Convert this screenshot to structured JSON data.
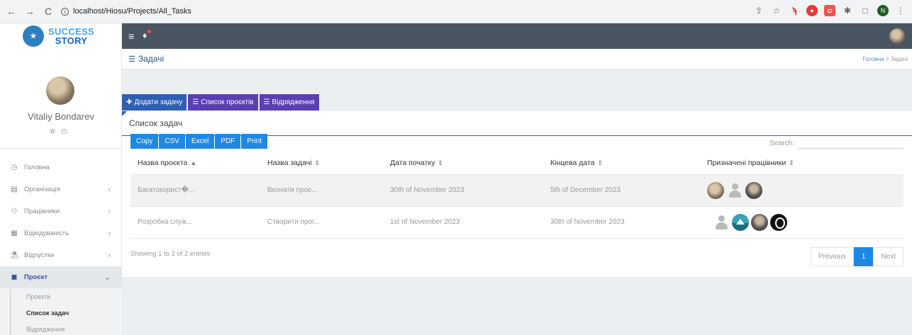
{
  "browser": {
    "url": "localhost/Hiosu/Projects/All_Tasks"
  },
  "brand": {
    "line1": "SUCCESS",
    "line2": "STORY"
  },
  "user": {
    "name": "Vitaliy Bondarev"
  },
  "sidebar": {
    "items": [
      {
        "label": "Головна",
        "icon": "dashboard-icon"
      },
      {
        "label": "Організація",
        "icon": "building-icon"
      },
      {
        "label": "Працівники",
        "icon": "users-icon"
      },
      {
        "label": "Відвідуваність",
        "icon": "clipboard-icon"
      },
      {
        "label": "Відпустки",
        "icon": "beach-icon"
      },
      {
        "label": "Проєкт",
        "icon": "briefcase-icon"
      }
    ],
    "submenu": [
      "Проєкти",
      "Список задач",
      "Відрядження"
    ]
  },
  "header": {
    "title": "Задачі",
    "breadcrumb_home": "Головна",
    "breadcrumb_sep": ">",
    "breadcrumb_current": "Задачі"
  },
  "actions": {
    "add_task": "Додати задачу",
    "projects_list": "Список проєктів",
    "trips": "Відрядження"
  },
  "card": {
    "title": "Список задач"
  },
  "exports": [
    "Copy",
    "CSV",
    "Excel",
    "PDF",
    "Print"
  ],
  "search": {
    "label": "Search:"
  },
  "table": {
    "columns": [
      "Назва проєкта",
      "Назва задачі",
      "Дата початку",
      "Кінцева дата",
      "Призначені працівники"
    ],
    "rows": [
      {
        "project": "Багатокорист�...",
        "task": "Вконати проє...",
        "start": "30th of November 2023",
        "end": "5th of December 2023"
      },
      {
        "project": "Розробка служ...",
        "task": "Створити прог...",
        "start": "1st of November 2023",
        "end": "30th of November 2023"
      }
    ]
  },
  "footer": {
    "info": "Showing 1 to 2 of 2 entries",
    "prev": "Previous",
    "page": "1",
    "next": "Next"
  }
}
